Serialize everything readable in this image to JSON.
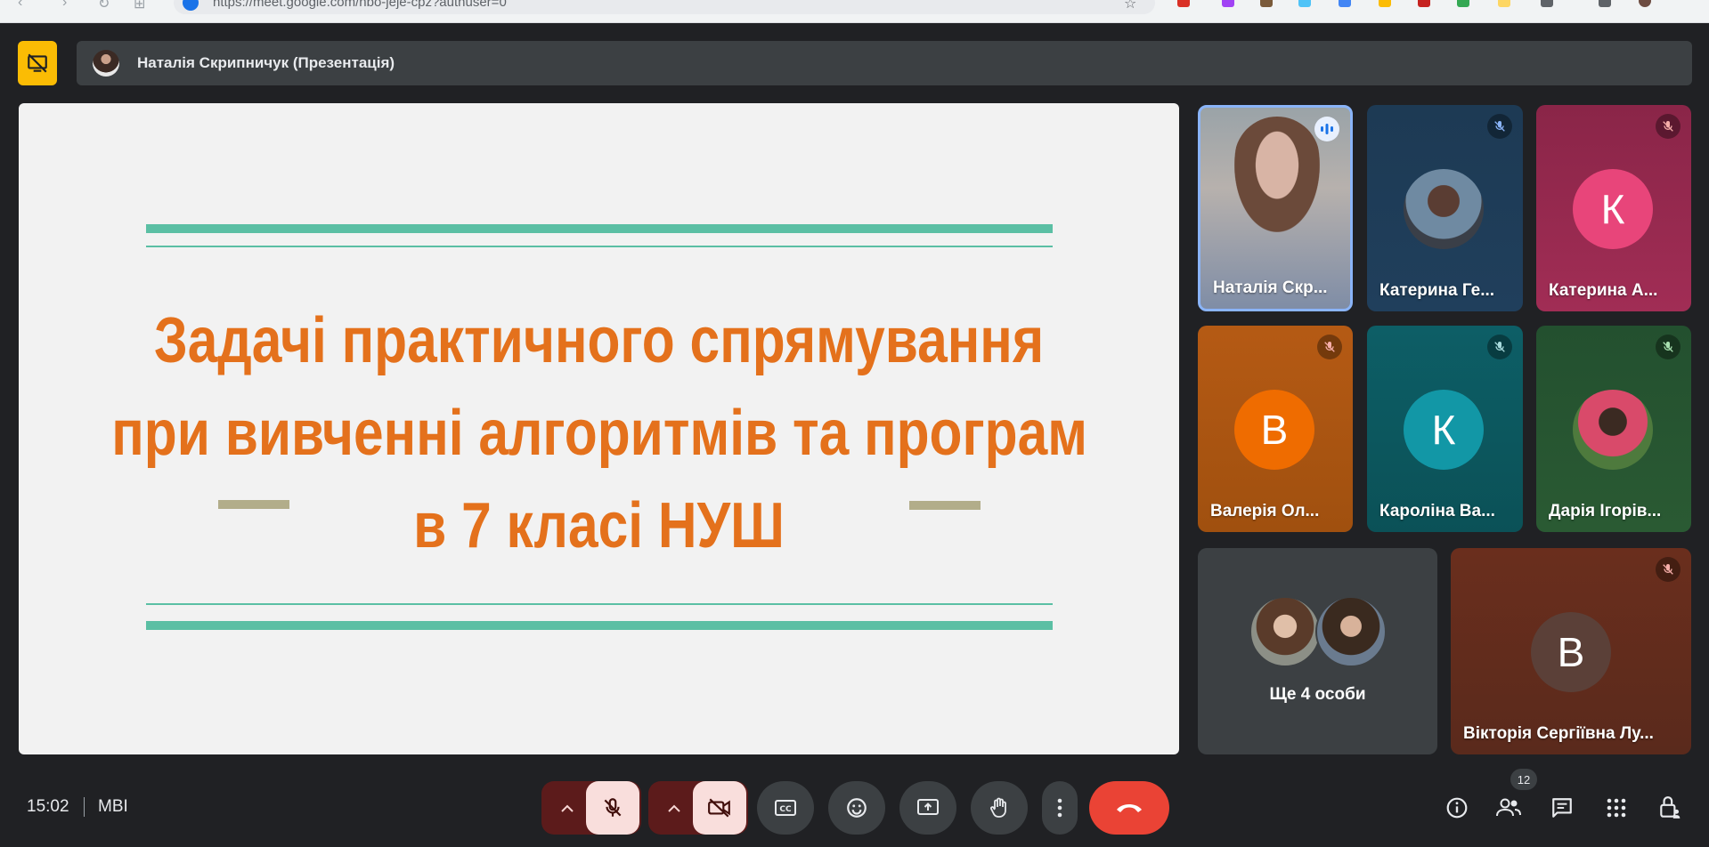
{
  "browser": {
    "url": "https://meet.google.com/nbo-jeje-cpz?authuser=0"
  },
  "presentation": {
    "presenter_label": "Наталія Скрипничук (Презентація)",
    "slide_title_lines": [
      "Задачі практичного спрямування",
      "при вивченні алгоритмів та програм",
      "в 7 класі НУШ"
    ]
  },
  "participants": [
    {
      "name": "Наталія Скр...",
      "kind": "video",
      "speaking": true
    },
    {
      "name": "Катерина Ге...",
      "kind": "photo",
      "muted": true
    },
    {
      "name": "Катерина А...",
      "initial": "К",
      "muted": true
    },
    {
      "name": "Валерія Ол...",
      "initial": "В",
      "muted": true
    },
    {
      "name": "Кароліна Ва...",
      "initial": "К",
      "muted": true
    },
    {
      "name": "Дарія Ігорів...",
      "kind": "photo",
      "muted": true
    },
    {
      "name": "Вікторія Сергіївна Лу...",
      "initial": "В",
      "muted": true
    }
  ],
  "others": {
    "label": "Ще 4 особи"
  },
  "footer": {
    "time": "15:02",
    "meeting_code": "MBI",
    "people_count": "12"
  },
  "colors": {
    "background": "#202124",
    "title_orange": "#e4711c",
    "slide_line": "#5bbfa4",
    "hangup": "#ea4335",
    "presenting_yellow": "#fbbc04"
  }
}
